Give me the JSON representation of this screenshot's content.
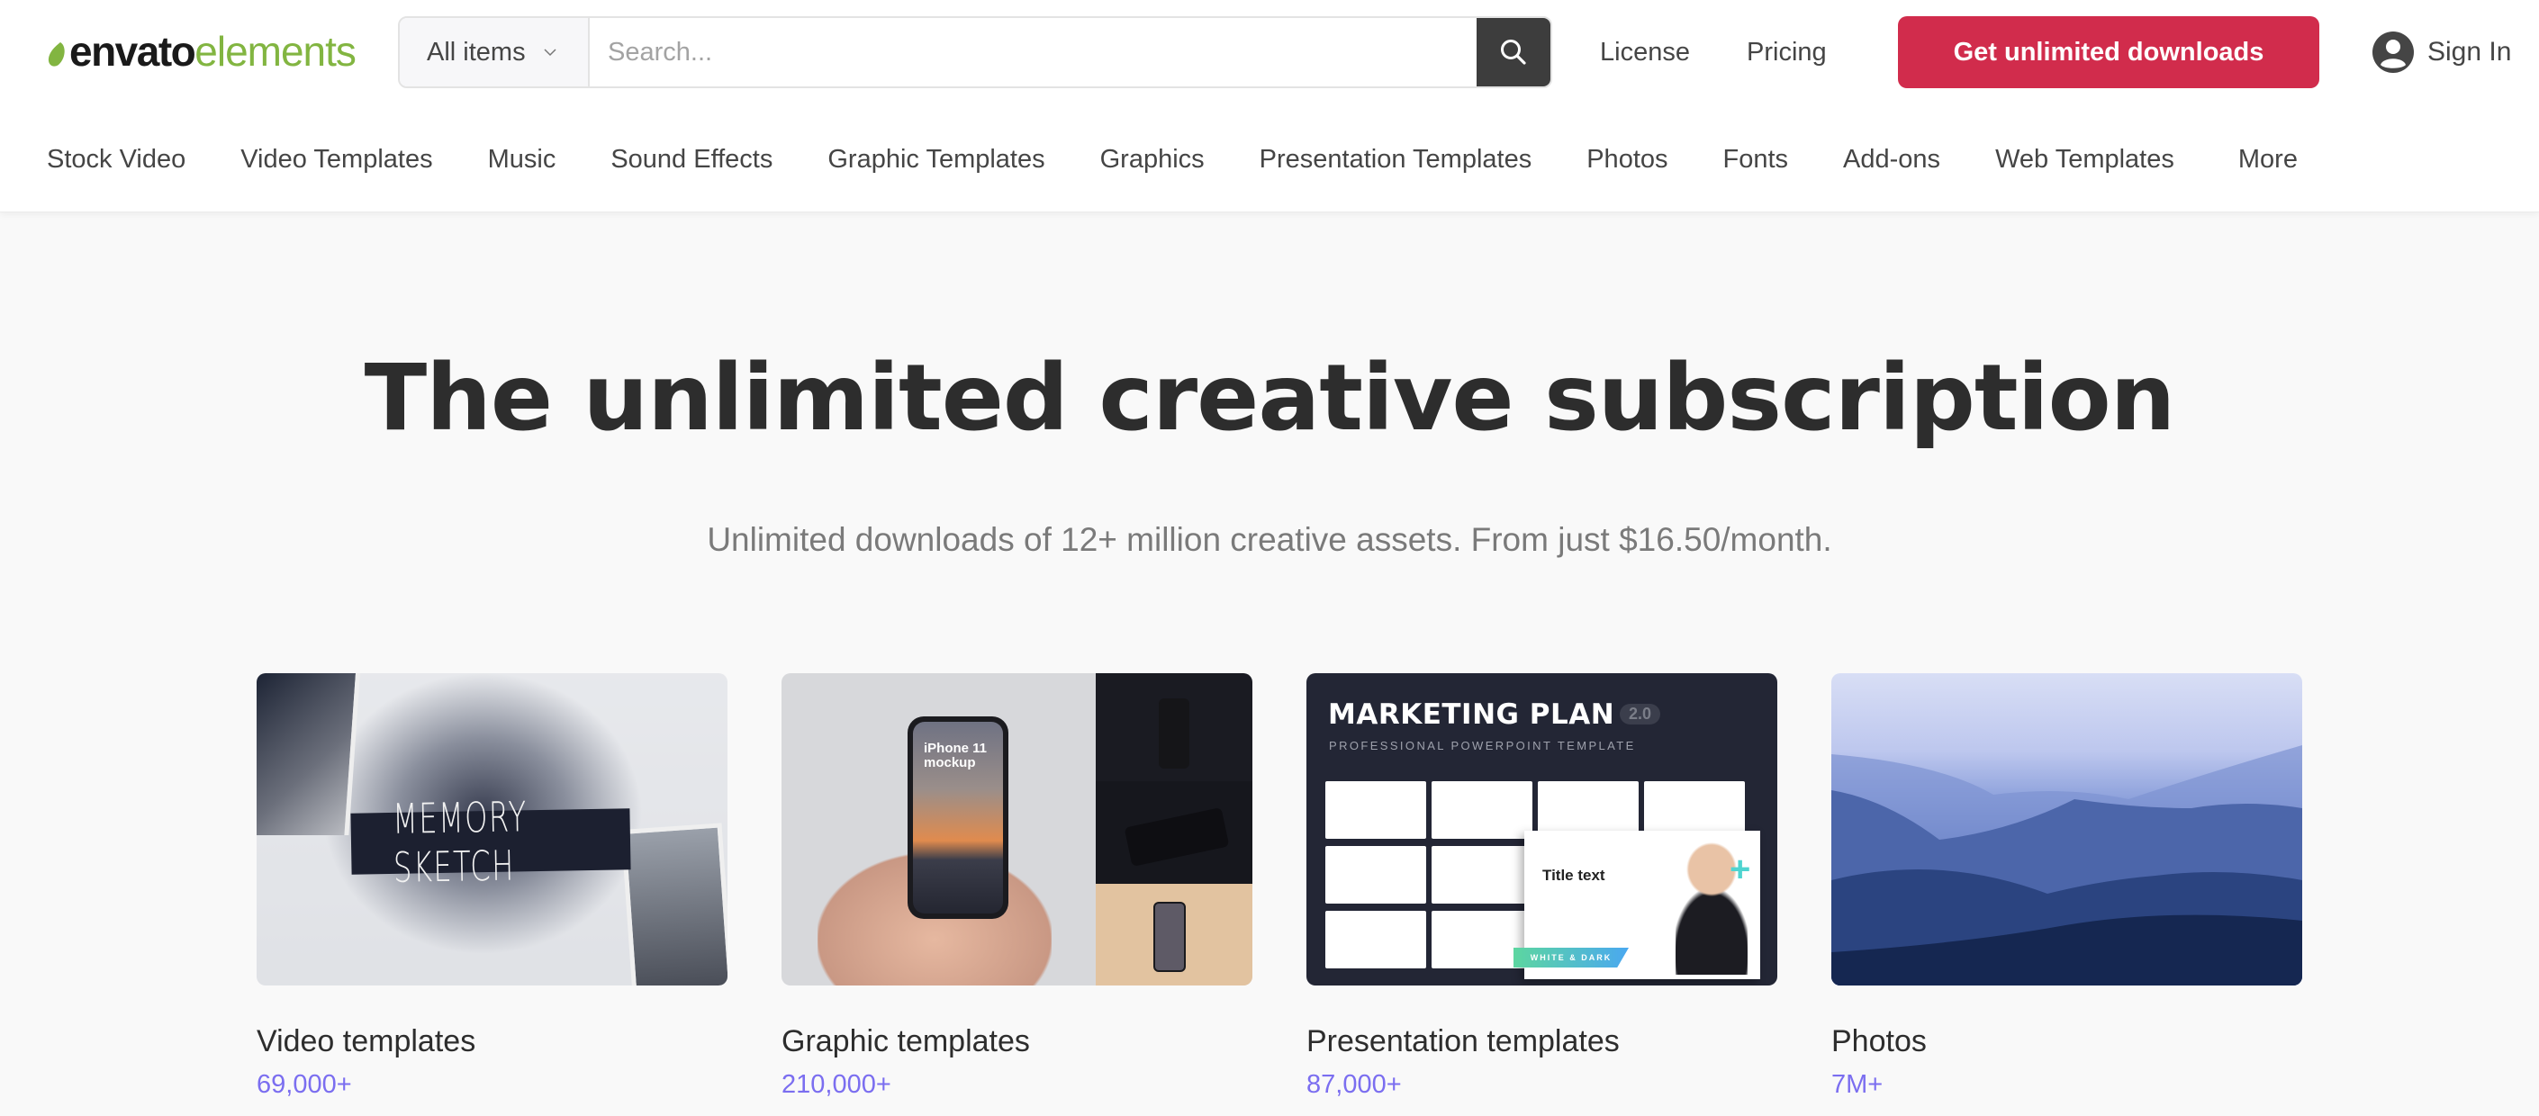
{
  "header": {
    "logo": {
      "part1": "envato",
      "part2": "elements",
      "leaf_color": "#82b541"
    },
    "search": {
      "category_label": "All items",
      "placeholder": "Search...",
      "value": ""
    },
    "links": {
      "license": "License",
      "pricing": "Pricing"
    },
    "cta_label": "Get unlimited downloads",
    "cta_color": "#d12c4c",
    "signin_label": "Sign In"
  },
  "nav": {
    "items": [
      "Stock Video",
      "Video Templates",
      "Music",
      "Sound Effects",
      "Graphic Templates",
      "Graphics",
      "Presentation Templates",
      "Photos",
      "Fonts",
      "Add-ons",
      "Web Templates"
    ],
    "more_label": "More"
  },
  "hero": {
    "title": "The unlimited creative subscription",
    "subtitle": "Unlimited downloads of 12+ million creative assets. From just $16.50/month."
  },
  "categories": [
    {
      "title": "Video templates",
      "count": "69,000+",
      "thumb_text": "MEMORY SKETCH"
    },
    {
      "title": "Graphic templates",
      "count": "210,000+",
      "thumb_text": "iPhone 11 mockup"
    },
    {
      "title": "Presentation templates",
      "count": "87,000+",
      "thumb_text": "MARKETING PLAN",
      "thumb_badge": "2.0",
      "thumb_sub": "PROFESSIONAL POWERPOINT TEMPLATE",
      "thumb_slide_title": "Title text",
      "thumb_tag": "WHITE & DARK"
    },
    {
      "title": "Photos",
      "count": "7M+"
    }
  ],
  "colors": {
    "count_accent": "#7b6ef0",
    "search_button": "#3d3d3d"
  }
}
